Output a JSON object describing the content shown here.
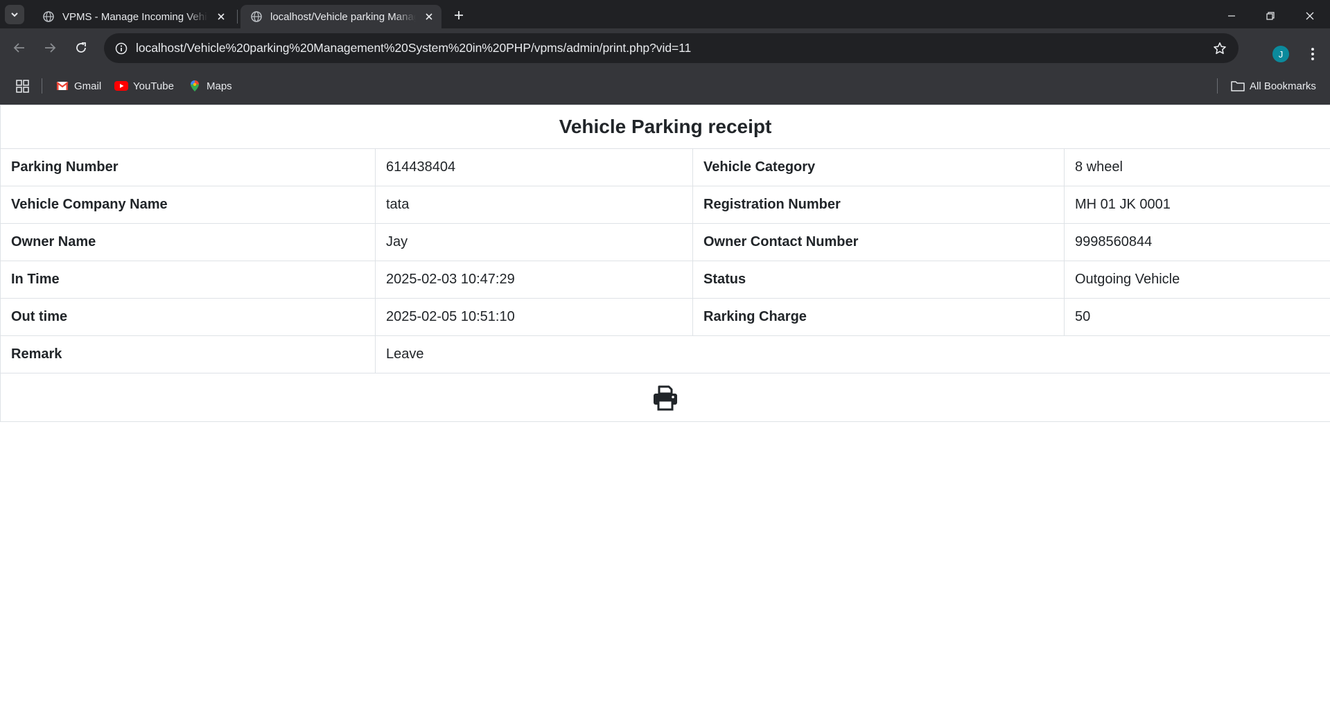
{
  "browser": {
    "tabs": [
      {
        "title": "VPMS - Manage Incoming Vehicle",
        "active": false
      },
      {
        "title": "localhost/Vehicle parking Management",
        "active": true
      }
    ],
    "url": "localhost/Vehicle%20parking%20Management%20System%20in%20PHP/vpms/admin/print.php?vid=11",
    "avatar_letter": "J",
    "bookmarks": [
      {
        "label": "Gmail",
        "icon": "gmail-icon"
      },
      {
        "label": "YouTube",
        "icon": "youtube-icon"
      },
      {
        "label": "Maps",
        "icon": "maps-icon"
      }
    ],
    "all_bookmarks_label": "All Bookmarks"
  },
  "receipt": {
    "title": "Vehicle Parking receipt",
    "rows": [
      {
        "label1": "Parking Number",
        "value1": "614438404",
        "label2": "Vehicle Category",
        "value2": "8 wheel"
      },
      {
        "label1": "Vehicle Company Name",
        "value1": "tata",
        "label2": "Registration Number",
        "value2": "MH 01 JK 0001"
      },
      {
        "label1": "Owner Name",
        "value1": "Jay",
        "label2": "Owner Contact Number",
        "value2": "9998560844"
      },
      {
        "label1": "In Time",
        "value1": "2025-02-03 10:47:29",
        "label2": "Status",
        "value2": "Outgoing Vehicle"
      },
      {
        "label1": "Out time",
        "value1": "2025-02-05 10:51:10",
        "label2": "Rarking Charge",
        "value2": "50"
      }
    ],
    "remark_label": "Remark",
    "remark_value": "Leave",
    "print_icon": "printer-icon"
  },
  "colors": {
    "chrome_dark": "#202124",
    "chrome_mid": "#35363a",
    "text": "#212529",
    "border": "#dee2e6"
  }
}
